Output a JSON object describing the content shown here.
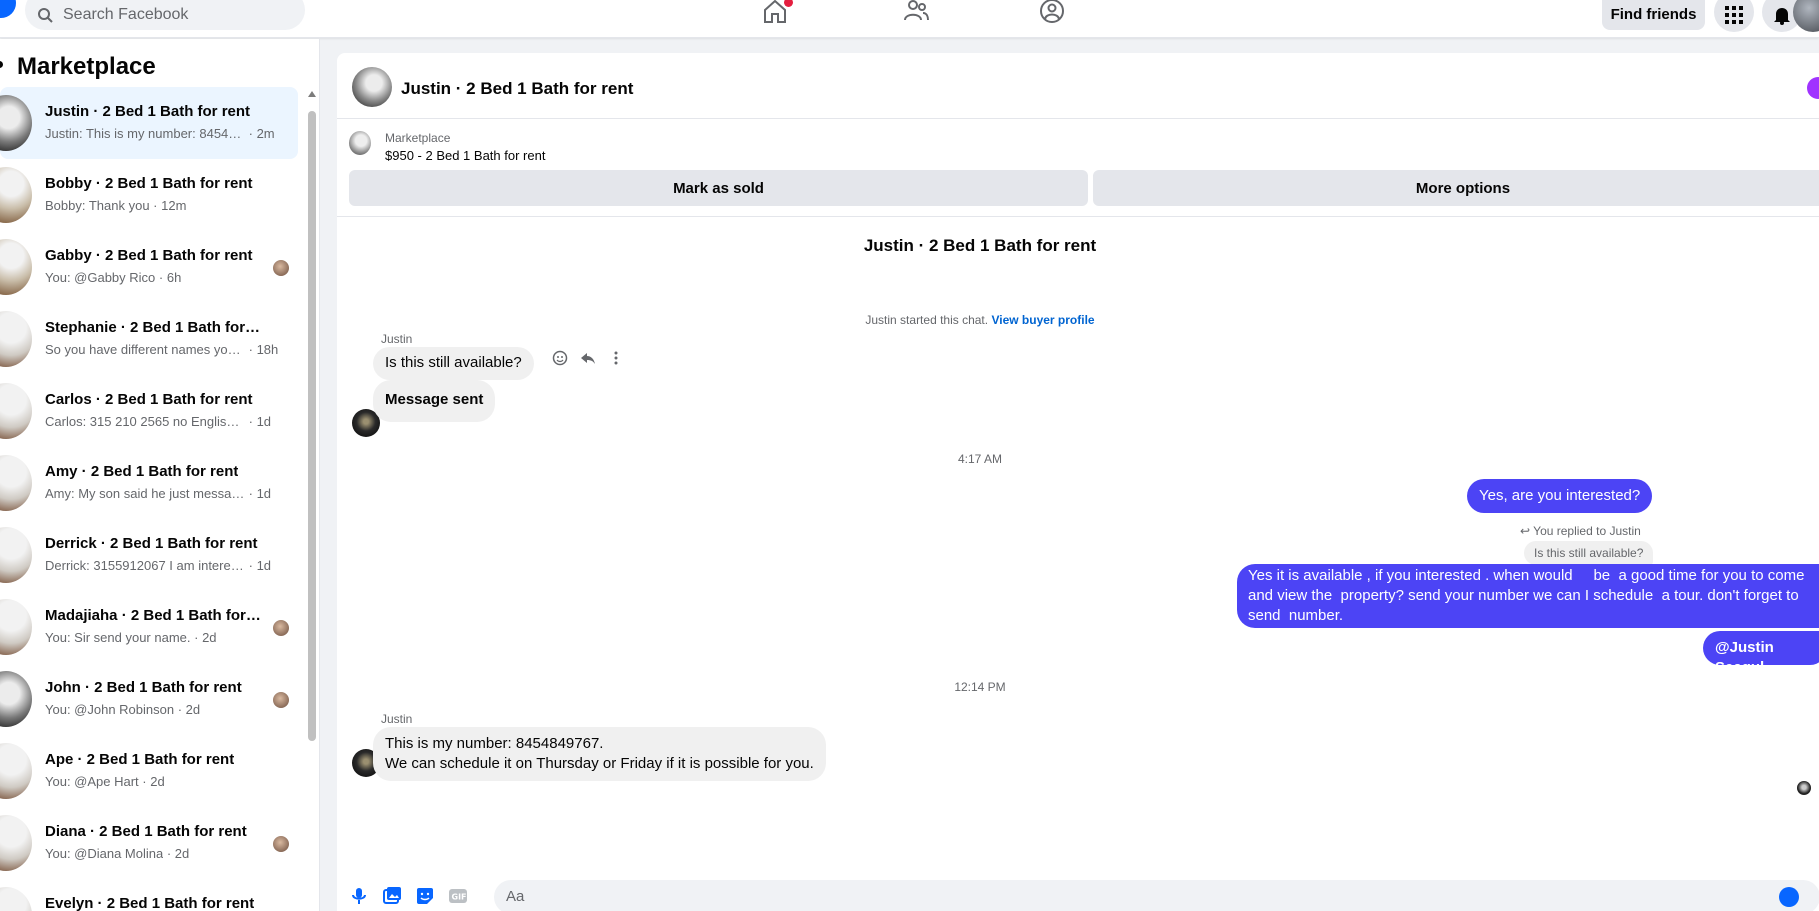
{
  "topbar": {
    "search_placeholder": "Search Facebook",
    "find_friends": "Find friends"
  },
  "sidebar": {
    "title": "Marketplace",
    "conversations": [
      {
        "name": "Justin · 2 Bed 1 Bath for rent",
        "snippet": "Justin: This is my number: 8454849...",
        "time": "2m",
        "active": true
      },
      {
        "name": "Bobby · 2 Bed 1 Bath for rent",
        "snippet": "Bobby: Thank you",
        "time": "12m"
      },
      {
        "name": "Gabby · 2 Bed 1 Bath for rent",
        "snippet": "You: @Gabby Rico",
        "time": "6h"
      },
      {
        "name": "Stephanie · 2 Bed 1 Bath for rent",
        "snippet": "So you have different names you ...",
        "time": "18h"
      },
      {
        "name": "Carlos · 2 Bed 1 Bath for rent",
        "snippet": "Carlos: 315 210 2565 no English y S...",
        "time": "1d"
      },
      {
        "name": "Amy · 2 Bed 1 Bath for rent",
        "snippet": "Amy: My son said he just message...",
        "time": "1d"
      },
      {
        "name": "Derrick · 2 Bed 1 Bath for rent",
        "snippet": "Derrick: 3155912067 I am interested",
        "time": "1d"
      },
      {
        "name": "Madajiaha · 2 Bed 1 Bath for r...",
        "snippet": "You: Sir send your name.",
        "time": "2d"
      },
      {
        "name": "John · 2 Bed 1 Bath for rent",
        "snippet": "You: @John Robinson",
        "time": "2d"
      },
      {
        "name": "Ape · 2 Bed 1 Bath for rent",
        "snippet": "You: @Ape Hart",
        "time": "2d"
      },
      {
        "name": "Diana · 2 Bed 1 Bath for rent",
        "snippet": "You: @Diana Molina",
        "time": "2d"
      },
      {
        "name": "Evelyn · 2 Bed 1 Bath for rent",
        "snippet": "",
        "time": ""
      }
    ]
  },
  "chat": {
    "header_title": "Justin · 2 Bed 1 Bath for rent",
    "listing": {
      "kind": "Marketplace",
      "title": "$950 - 2 Bed 1 Bath for rent",
      "mark_sold": "Mark as sold",
      "more_options": "More options"
    },
    "center_title": "Justin · 2 Bed 1 Bath for rent",
    "started_text": "Justin started this chat.",
    "view_buyer": "View buyer profile",
    "sender_name": "Justin",
    "msg_available": "Is this still available?",
    "msg_sent": "Message sent",
    "time_1": "4:17 AM",
    "out_interested": "Yes, are you interested?",
    "replied_to": "You replied to Justin",
    "quoted": "Is this still available?",
    "out_long_1": "Yes it is available , if you interested . when would     be  a good time for you to come",
    "out_long_2": "and view the  property? send your number we can I schedule  a tour. don't forget to",
    "out_long_3": "send  number.",
    "out_mention": "@Justin Seagul",
    "time_2": "12:14 PM",
    "sender_name_2": "Justin",
    "in_number_1": "This is my number: 8454849767.",
    "in_number_2": "We can schedule it on Thursday or Friday if it is possible for you.",
    "composer_placeholder": "Aa"
  }
}
